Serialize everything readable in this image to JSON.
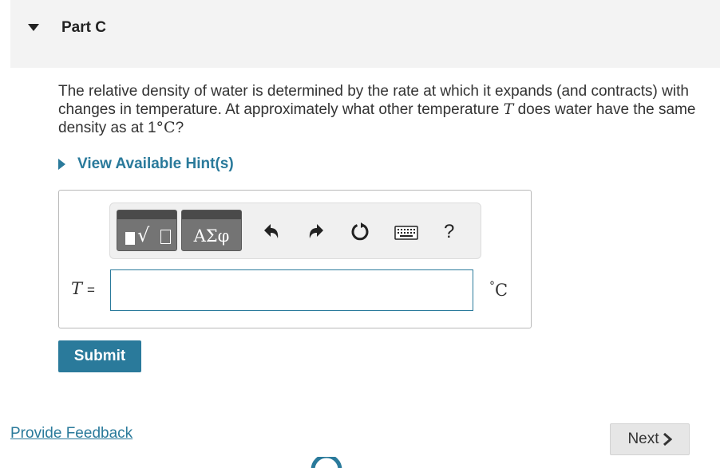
{
  "part": {
    "title": "Part C"
  },
  "question": {
    "line1": "The relative density of water is determined by the rate at which it expands (and contracts) with",
    "line2_a": "changes in temperature. At approximately what other temperature ",
    "variable": "T",
    "line2_b": " does water have the same",
    "line3_a": "density as at ",
    "temp_value": "1",
    "degree": "°",
    "temp_unit": "C",
    "line3_b": "?"
  },
  "hints": {
    "label": "View Available Hint(s)"
  },
  "toolbar": {
    "templates_icon": "templates-sqrt-icon",
    "templates_glyph": "√",
    "symbols_label": "ΑΣφ",
    "undo_icon": "undo-icon",
    "redo_icon": "redo-icon",
    "reset_icon": "reset-icon",
    "keyboard_icon": "keyboard-icon",
    "help_label": "?"
  },
  "answer": {
    "variable": "T",
    "equals": "=",
    "value": "",
    "unit_degree": "°",
    "unit": "C"
  },
  "actions": {
    "submit_label": "Submit",
    "feedback_label": "Provide Feedback",
    "next_label": "Next"
  },
  "colors": {
    "accent": "#2a7a9b",
    "header_bg": "#f3f3f3",
    "toolbar_button": "#747474"
  }
}
